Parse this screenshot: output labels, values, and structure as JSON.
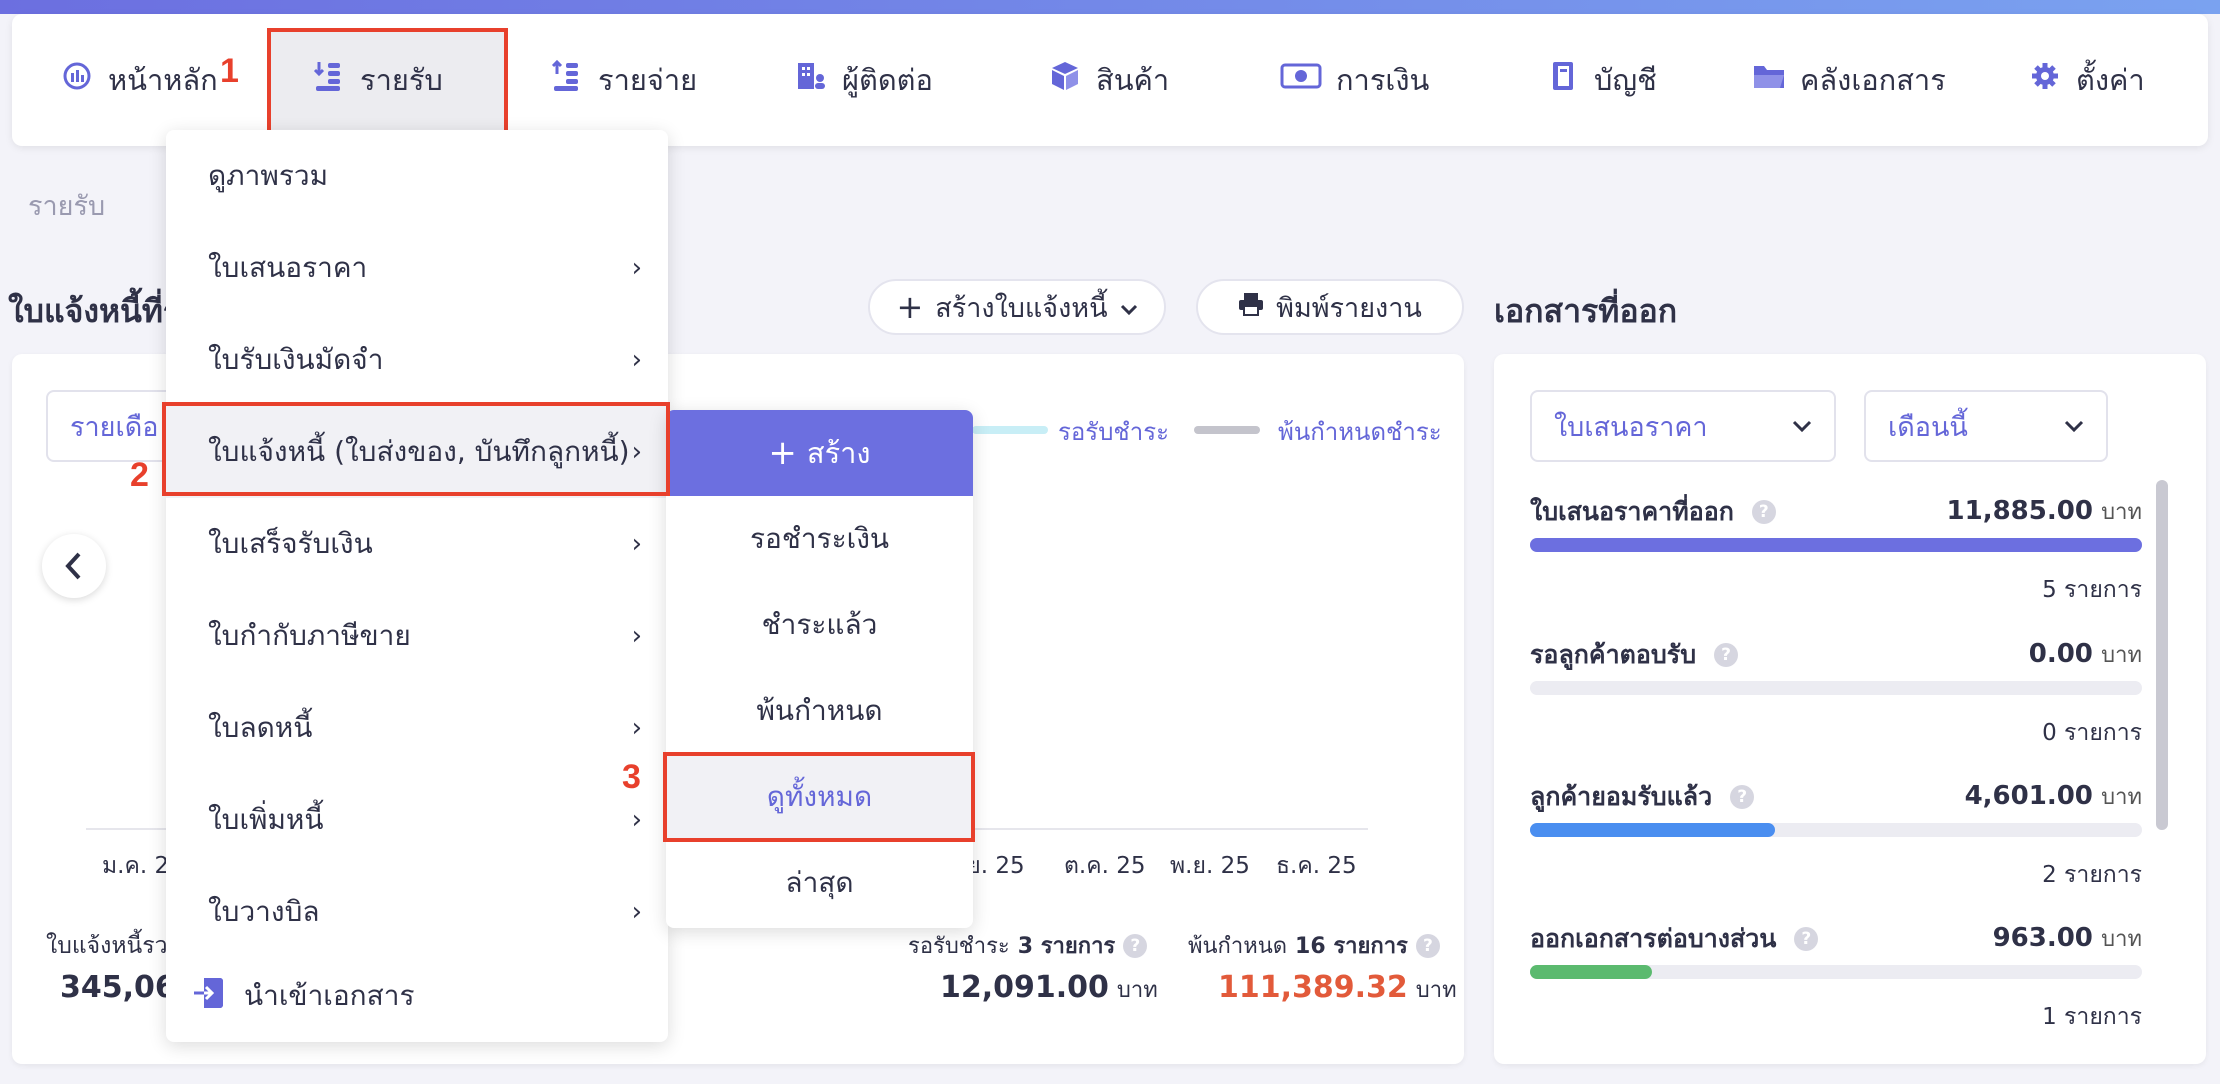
{
  "nav": {
    "items": [
      {
        "label": "หน้าหลัก",
        "icon": "dashboard-gauge-icon"
      },
      {
        "label": "รายรับ",
        "icon": "income-coins-icon"
      },
      {
        "label": "รายจ่าย",
        "icon": "expense-coins-icon"
      },
      {
        "label": "ผู้ติดต่อ",
        "icon": "contacts-building-icon"
      },
      {
        "label": "สินค้า",
        "icon": "product-box-icon"
      },
      {
        "label": "การเงิน",
        "icon": "money-bill-icon"
      },
      {
        "label": "บัญชี",
        "icon": "ledger-book-icon"
      },
      {
        "label": "คลังเอกสาร",
        "icon": "folder-icon"
      },
      {
        "label": "ตั้งค่า",
        "icon": "gear-icon"
      }
    ]
  },
  "steps": {
    "one": "1",
    "two": "2",
    "three": "3"
  },
  "breadcrumb": "รายรับ",
  "left_section": {
    "title": "ใบแจ้งหนี้ที่รั",
    "create_button": "สร้างใบแจ้งหนี้",
    "print_button": "พิมพ์รายงาน",
    "period_select": "รายเดือ",
    "legend": [
      {
        "label": "รอรับชำระ",
        "color": "#c8eef6"
      },
      {
        "label": "พ้นกำหนดชำระ",
        "color": "#c4c4cc"
      }
    ],
    "x_labels": [
      "ม.ค. 2",
      ".ย. 25",
      "ต.ค. 25",
      "พ.ย. 25",
      "ธ.ค. 25"
    ],
    "summary": {
      "total_label": "ใบแจ้งหนี้รวม",
      "total_value": "345,06",
      "pending_label": "รอรับชำระ",
      "pending_count": "3 รายการ",
      "pending_value": "12,091.00",
      "overdue_label": "พ้นกำหนด",
      "overdue_count": "16 รายการ",
      "overdue_value": "111,389.32",
      "currency": "บาท"
    }
  },
  "menu": {
    "items": [
      {
        "label": "ดูภาพรวม",
        "has_sub": false
      },
      {
        "label": "ใบเสนอราคา",
        "has_sub": true
      },
      {
        "label": "ใบรับเงินมัดจำ",
        "has_sub": true
      },
      {
        "label": "ใบแจ้งหนี้ (ใบส่งของ, บันทึกลูกหนี้)",
        "has_sub": true
      },
      {
        "label": "ใบเสร็จรับเงิน",
        "has_sub": true
      },
      {
        "label": "ใบกำกับภาษีขาย",
        "has_sub": true
      },
      {
        "label": "ใบลดหนี้",
        "has_sub": true
      },
      {
        "label": "ใบเพิ่มหนี้",
        "has_sub": true
      },
      {
        "label": "ใบวางบิล",
        "has_sub": true
      }
    ],
    "import_label": "นำเข้าเอกสาร",
    "arrow": "›"
  },
  "submenu": {
    "create": "สร้าง",
    "items": [
      "รอชำระเงิน",
      "ชำระแล้ว",
      "พ้นกำหนด",
      "ดูทั้งหมด",
      "ล่าสุด"
    ]
  },
  "right_section": {
    "title": "เอกสารที่ออก",
    "doc_select": "ใบเสนอราคา",
    "period_select": "เดือนนี้",
    "stats": [
      {
        "name": "ใบเสนอราคาที่ออก",
        "amount": "11,885.00",
        "unit": "บาท",
        "count": "5 รายการ",
        "fill": 1.0,
        "color": "#6c6fe0"
      },
      {
        "name": "รอลูกค้าตอบรับ",
        "amount": "0.00",
        "unit": "บาท",
        "count": "0 รายการ",
        "fill": 0.0,
        "color": "#6c6fe0"
      },
      {
        "name": "ลูกค้ายอมรับแล้ว",
        "amount": "4,601.00",
        "unit": "บาท",
        "count": "2 รายการ",
        "fill": 0.4,
        "color": "#4a8ef0"
      },
      {
        "name": "ออกเอกสารต่อบางส่วน",
        "amount": "963.00",
        "unit": "บาท",
        "count": "1 รายการ",
        "fill": 0.2,
        "color": "#5bba6f"
      }
    ]
  },
  "glyphs": {
    "plus": "+",
    "chevron_down": "⌄",
    "chevron_left": "‹",
    "question": "?",
    "printer": "🖶",
    "import": "⇥"
  }
}
